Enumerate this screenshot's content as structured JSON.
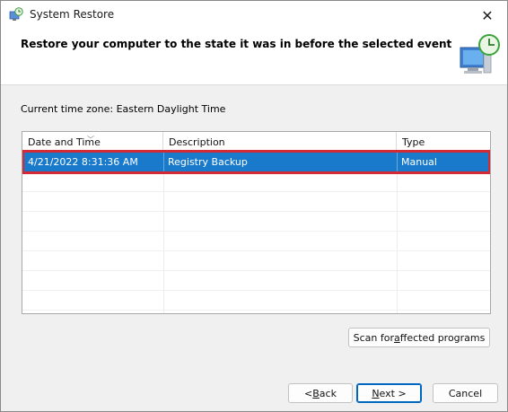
{
  "window": {
    "title": "System Restore",
    "close_glyph": "✕"
  },
  "header": {
    "title": "Restore your computer to the state it was in before the selected event"
  },
  "timezone_label": "Current time zone: Eastern Daylight Time",
  "table": {
    "columns": [
      "Date and Time",
      "Description",
      "Type"
    ],
    "rows": [
      {
        "date_time": "4/21/2022 8:31:36 AM",
        "description": "Registry Backup",
        "type": "Manual"
      }
    ]
  },
  "buttons": {
    "scan_pre": "Scan for ",
    "scan_u": "a",
    "scan_post": "ffected programs",
    "back_pre": "< ",
    "back_u": "B",
    "back_post": "ack",
    "next_u": "N",
    "next_post": "ext >",
    "cancel": "Cancel"
  },
  "colors": {
    "selection": "#1979ca",
    "highlight_outline": "#d42a35",
    "default_button_border": "#0067c0"
  },
  "icons": {
    "title": "system-restore-icon",
    "header": "system-restore-monitor-clock-icon"
  }
}
